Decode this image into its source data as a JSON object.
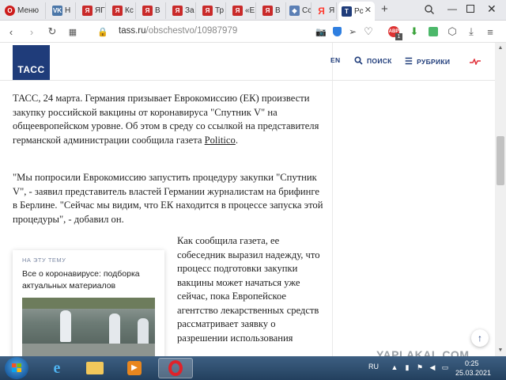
{
  "browser": {
    "tabs": [
      {
        "label": "Меню",
        "favicon": "opera-icon",
        "color": "#cc1b1b"
      },
      {
        "label": "Н",
        "favicon": "vk-icon",
        "color": "#4a76a8"
      },
      {
        "label": "ЯГ",
        "favicon": "yaplakal-icon",
        "color": "#c92a2a"
      },
      {
        "label": "Кс",
        "favicon": "yaplakal-icon",
        "color": "#c92a2a"
      },
      {
        "label": "В",
        "favicon": "yaplakal-icon",
        "color": "#c92a2a"
      },
      {
        "label": "За",
        "favicon": "yaplakal-icon",
        "color": "#c92a2a"
      },
      {
        "label": "Тр",
        "favicon": "yaplakal-icon",
        "color": "#c92a2a"
      },
      {
        "label": "«Е",
        "favicon": "yaplakal-icon",
        "color": "#c92a2a"
      },
      {
        "label": "В",
        "favicon": "yaplakal-icon",
        "color": "#c92a2a"
      },
      {
        "label": "Сс",
        "favicon": "shield-icon",
        "color": "#5b7fb5"
      },
      {
        "label": "Я",
        "favicon": "yandex-icon",
        "color": "#ff3b30"
      },
      {
        "label": "Рс",
        "favicon": "tass-icon",
        "color": "#1f3c7a",
        "active": true
      }
    ],
    "new_tab_symbol": "+",
    "url_host": "tass.ru",
    "url_path": "/obschestvo/10987979",
    "extension_badge": "1"
  },
  "site": {
    "logo": "ТАСС",
    "nav": {
      "lang": "EN",
      "search": "ПОИСК",
      "rubrics": "РУБРИКИ"
    },
    "accent_color": "#1f3c7a"
  },
  "article": {
    "p1_lead": "ТАСС, 24 марта. Германия призывает Еврокомиссию (ЕК) произвести закупку российской вакцины от коронавируса \"Спутник V\" на общеевропейском уровне. Об этом в среду со ссылкой на представителя германской администрации сообщила газета ",
    "p1_link": "Politico",
    "p1_end": ".",
    "p2": "\"Мы попросили Еврокомиссию запустить процедуру закупки \"Спутник V\", - заявил представитель властей Германии журналистам на брифинге в Берлине. \"Сейчас мы видим, что ЕК находится в процессе запуска этой процедуры\", - добавил он.",
    "p3": "Как сообщила газета, ее собеседник выразил надежду, что процесс подготовки закупки вакцины может начаться уже сейчас, пока Европейское агентство лекарственных средств рассматривает заявку о разрешении использования"
  },
  "related": {
    "eyebrow": "НА ЭТУ ТЕМУ",
    "title": "Все о коронавирусе: подборка актуальных материалов"
  },
  "taskbar": {
    "lang": "RU",
    "time": "0:25",
    "date": "25.03.2021"
  },
  "watermark": "YAPLAKAL.COM"
}
